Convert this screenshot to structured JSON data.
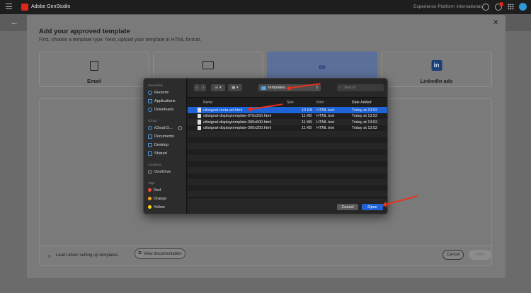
{
  "topbar": {
    "app_title": "Adobe GenStudio",
    "org_name": "Experience Platform International"
  },
  "modal": {
    "title": "Add your approved template",
    "subtitle": "First, choose a template type. Next, upload your template in HTML format.",
    "template_types": [
      {
        "label": "Email",
        "icon": "email-icon",
        "selected": false
      },
      {
        "label": "",
        "icon": "display-ad-icon",
        "selected": false
      },
      {
        "label": "",
        "icon": "meta-icon",
        "selected": true
      },
      {
        "label": "LinkedIn ads",
        "icon": "linkedin-icon",
        "selected": false
      }
    ],
    "learn_text": "Learn about setting up templates.",
    "view_doc_label": "View documentation",
    "cancel_label": "Cancel",
    "next_label": "Next"
  },
  "file_dialog": {
    "sidebar": {
      "favourites_header": "Favourites",
      "favourites": [
        "Recents",
        "Applications",
        "Downloads"
      ],
      "icloud_header": "iCloud",
      "icloud": [
        "iCloud D...",
        "Documents",
        "Desktop",
        "Shared"
      ],
      "locations_header": "Locations",
      "locations": [
        "OneDrive"
      ],
      "tags_header": "Tags",
      "tags": [
        {
          "label": "Red",
          "color": "#ff453a"
        },
        {
          "label": "Orange",
          "color": "#ff9f0a"
        },
        {
          "label": "Yellow",
          "color": "#ffd60a"
        }
      ]
    },
    "toolbar": {
      "back": "‹",
      "forward": "›",
      "current_folder": "templates",
      "search_placeholder": "Search"
    },
    "columns": {
      "name": "Name",
      "size": "Size",
      "kind": "Kind",
      "date": "Date Added"
    },
    "files": [
      {
        "name": "citisignal-meta-ad.html",
        "size": "10 KB",
        "kind": "HTML text",
        "date": "Today at 13:52",
        "selected": true
      },
      {
        "name": "citisignal-displaytemplate-970x250.html",
        "size": "11 KB",
        "kind": "HTML text",
        "date": "Today at 13:52",
        "selected": false
      },
      {
        "name": "citisignal-displaytemplate-300x600.html",
        "size": "11 KB",
        "kind": "HTML text",
        "date": "Today at 13:52",
        "selected": false
      },
      {
        "name": "citisignal-displaytemplate-300x250.html",
        "size": "11 KB",
        "kind": "HTML text",
        "date": "Today at 13:52",
        "selected": false
      }
    ],
    "cancel_label": "Cancel",
    "open_label": "Open"
  },
  "colors": {
    "selection": "#1f63d8",
    "annotation_arrow": "#e8321e",
    "accent": "#4a9be8"
  }
}
